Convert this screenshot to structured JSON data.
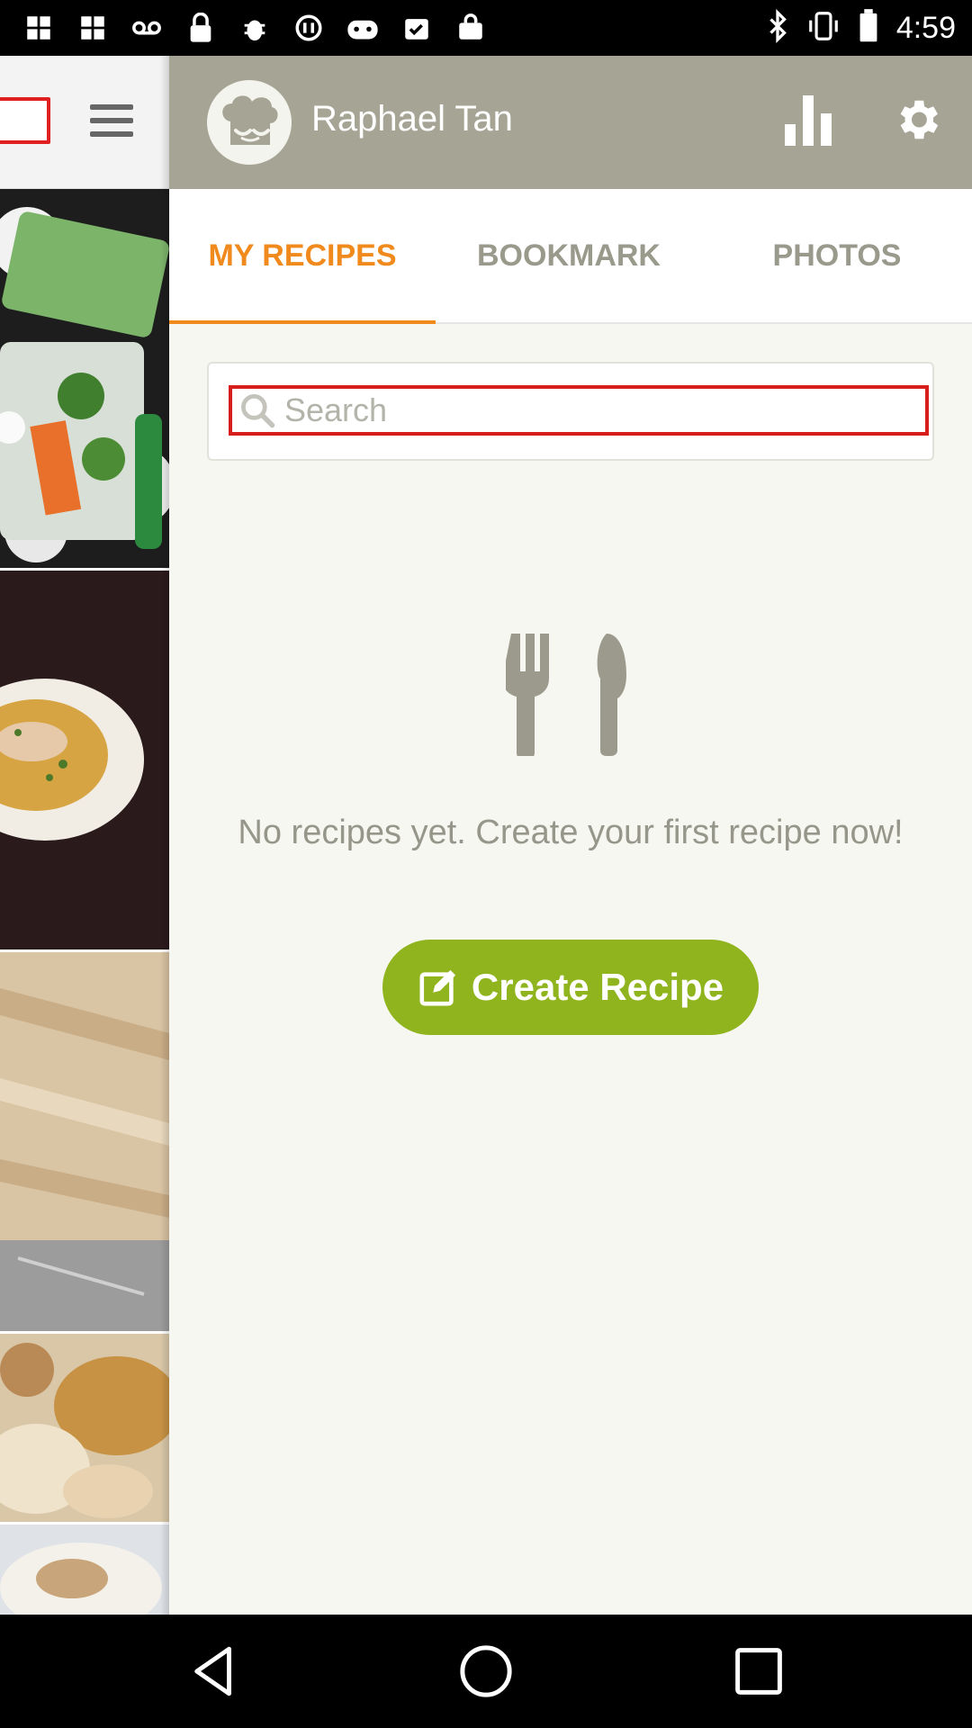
{
  "status_bar": {
    "time": "4:59",
    "left_icons": [
      "notification-icon",
      "notification-icon",
      "voicemail-icon",
      "lock-icon",
      "bug-icon",
      "block-icon",
      "bot-icon",
      "calendar-check-icon",
      "shopping-bag-icon"
    ],
    "right_icons": [
      "bluetooth-icon",
      "vibrate-icon",
      "battery-icon"
    ]
  },
  "header": {
    "username": "Raphael Tan",
    "avatar_icon": "chef-hat-icon",
    "stats_icon": "bar-chart-icon",
    "settings_icon": "gear-icon"
  },
  "tabs": [
    {
      "label": "MY RECIPES",
      "active": true
    },
    {
      "label": "BOOKMARK",
      "active": false
    },
    {
      "label": "PHOTOS",
      "active": false
    }
  ],
  "search": {
    "placeholder": "Search"
  },
  "empty_state": {
    "icon": "fork-knife-icon",
    "message": "No recipes yet. Create your first recipe now!"
  },
  "create_button": {
    "label": "Create Recipe",
    "icon": "edit-icon"
  },
  "colors": {
    "header_bg": "#a6a595",
    "accent_orange": "#f08a1c",
    "button_green": "#8fb41e",
    "panel_bg": "#f7f7f2"
  },
  "nav_bar": {
    "icons": [
      "back-icon",
      "home-icon",
      "recents-icon"
    ]
  }
}
